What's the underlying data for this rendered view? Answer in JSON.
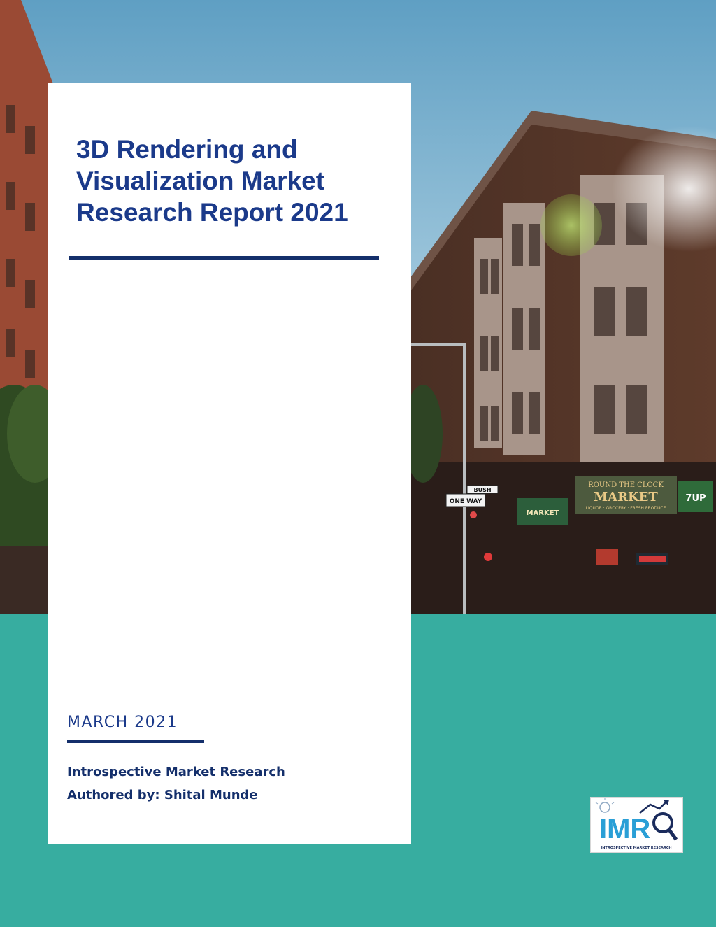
{
  "cover": {
    "title": "3D Rendering and Visualization Market Research Report 2021",
    "date": "MARCH 2021",
    "publisher": "Introspective Market Research",
    "author_line": "Authored by: Shital Munde"
  },
  "photo": {
    "signs": {
      "store_upper": "ROUND THE CLOCK",
      "store_name": "MARKET",
      "store_sub": "LIQUOR · GROCERY · FRESH PRODUCE",
      "one_way": "ONE WAY",
      "street": "BUSH",
      "small_market": "MARKET",
      "soda": "7UP"
    }
  },
  "logo": {
    "letters": "IMR",
    "caption": "INTROSPECTIVE MARKET RESEARCH"
  },
  "colors": {
    "title_blue": "#1b3a8a",
    "rule_navy": "#142f6b",
    "teal": "#37ada0",
    "sky": "#8fb9d3"
  }
}
